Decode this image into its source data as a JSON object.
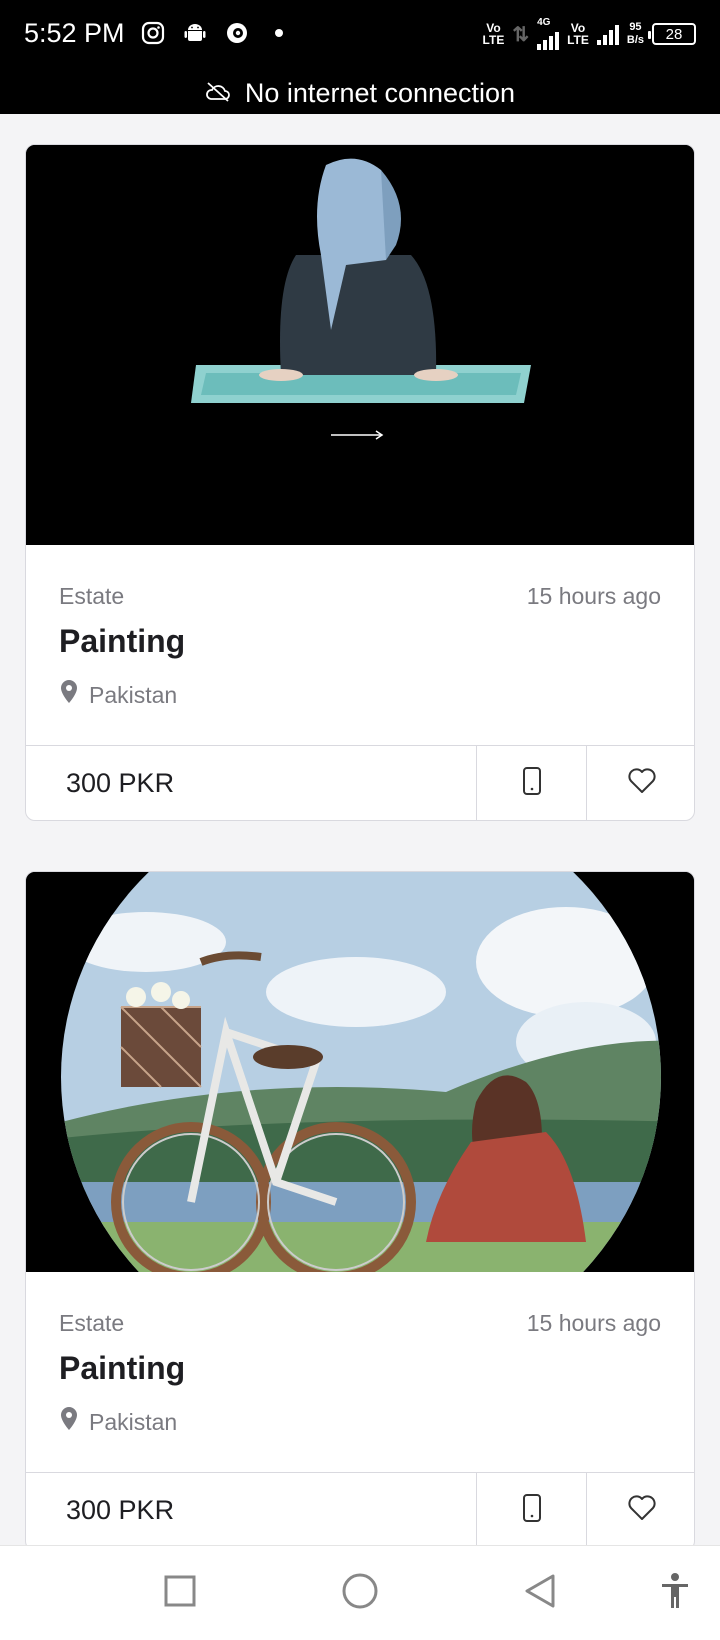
{
  "status_bar": {
    "time": "5:52 PM",
    "net_speed_value": "95",
    "net_speed_unit": "B/s",
    "battery": "28",
    "lte_1": [
      "Vo",
      "LTE"
    ],
    "lte_2": [
      "Vo",
      "LTE"
    ],
    "network_type": "4G"
  },
  "banner": {
    "text": "No internet connection"
  },
  "listings": [
    {
      "category": "Estate",
      "time": "15 hours ago",
      "title": "Painting",
      "location": "Pakistan",
      "price": "300 PKR"
    },
    {
      "category": "Estate",
      "time": "15 hours ago",
      "title": "Painting",
      "location": "Pakistan",
      "price": "300 PKR"
    }
  ],
  "colors": {
    "background": "#f4f4f6",
    "text_primary": "#1e1e22",
    "text_secondary": "#7a7a80",
    "border": "#d9d9df"
  },
  "icons": {
    "status_left": [
      "instagram-icon",
      "android-icon",
      "app-icon",
      "dot-icon"
    ],
    "location": "map-pin-icon",
    "phone": "phone-icon",
    "favorite": "heart-icon",
    "nav": [
      "recents-icon",
      "home-icon",
      "back-icon",
      "accessibility-icon"
    ]
  }
}
